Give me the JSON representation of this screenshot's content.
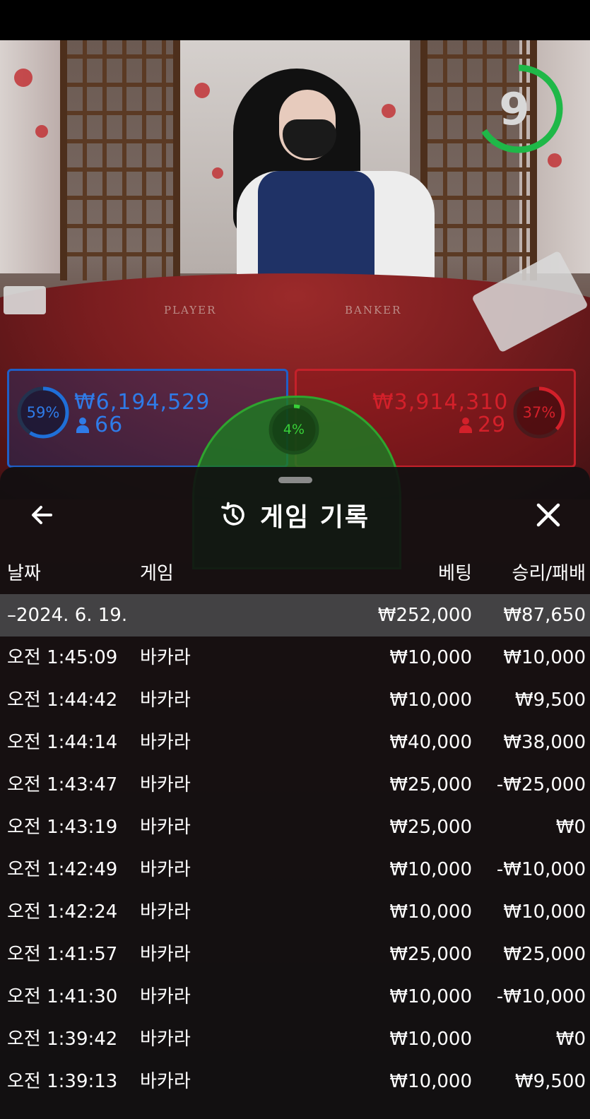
{
  "stream": {
    "countdown": "9",
    "table_labels": {
      "player": "PLAYER",
      "banker": "BANKER"
    }
  },
  "bets": {
    "player": {
      "percent": "59%",
      "amount": "₩6,194,529",
      "players": "66",
      "percent_value": 0.59
    },
    "banker": {
      "percent": "37%",
      "amount": "₩3,914,310",
      "players": "29",
      "percent_value": 0.37
    },
    "tie": {
      "percent": "4%",
      "percent_value": 0.04
    }
  },
  "colors": {
    "player": "#1f6fd8",
    "banker": "#d3202a",
    "tie": "#2fa52f",
    "timer": "#1fb848"
  },
  "history": {
    "title": "게임 기록",
    "icons": {
      "back": "arrow-left-icon",
      "title": "history-clock-icon",
      "close": "close-icon"
    },
    "columns": {
      "date": "날짜",
      "game": "게임",
      "bet": "베팅",
      "result": "승리/패배"
    },
    "date_group": {
      "label": "–2024. 6. 19.",
      "bet": "₩252,000",
      "result": "₩87,650"
    },
    "rows": [
      {
        "time": "오전 1:45:09",
        "game": "바카라",
        "bet": "₩10,000",
        "result": "₩10,000"
      },
      {
        "time": "오전 1:44:42",
        "game": "바카라",
        "bet": "₩10,000",
        "result": "₩9,500"
      },
      {
        "time": "오전 1:44:14",
        "game": "바카라",
        "bet": "₩40,000",
        "result": "₩38,000"
      },
      {
        "time": "오전 1:43:47",
        "game": "바카라",
        "bet": "₩25,000",
        "result": "-₩25,000"
      },
      {
        "time": "오전 1:43:19",
        "game": "바카라",
        "bet": "₩25,000",
        "result": "₩0"
      },
      {
        "time": "오전 1:42:49",
        "game": "바카라",
        "bet": "₩10,000",
        "result": "-₩10,000"
      },
      {
        "time": "오전 1:42:24",
        "game": "바카라",
        "bet": "₩10,000",
        "result": "₩10,000"
      },
      {
        "time": "오전 1:41:57",
        "game": "바카라",
        "bet": "₩25,000",
        "result": "₩25,000"
      },
      {
        "time": "오전 1:41:30",
        "game": "바카라",
        "bet": "₩10,000",
        "result": "-₩10,000"
      },
      {
        "time": "오전 1:39:42",
        "game": "바카라",
        "bet": "₩10,000",
        "result": "₩0"
      },
      {
        "time": "오전 1:39:13",
        "game": "바카라",
        "bet": "₩10,000",
        "result": "₩9,500"
      }
    ]
  }
}
